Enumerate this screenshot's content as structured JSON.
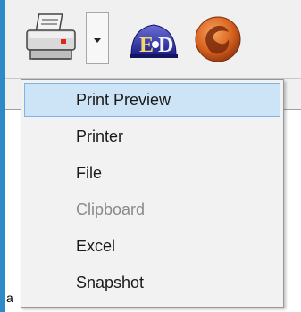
{
  "toolbar": {
    "printer_icon": "printer-icon",
    "dropdown_icon": "chevron-down-icon",
    "edb_icon": "edb-logo-icon",
    "orb_icon": "orange-swirl-icon",
    "edb_text": "E",
    "edb_text2": "D"
  },
  "menu": {
    "items": [
      {
        "label": "Print Preview",
        "state": "highlighted"
      },
      {
        "label": "Printer",
        "state": "enabled"
      },
      {
        "label": "File",
        "state": "enabled"
      },
      {
        "label": "Clipboard",
        "state": "disabled"
      },
      {
        "label": "Excel",
        "state": "enabled"
      },
      {
        "label": "Snapshot",
        "state": "enabled"
      }
    ]
  },
  "content": {
    "visible_text": "a"
  },
  "colors": {
    "frame_accent": "#2d89c8",
    "menu_highlight": "#cde4f7",
    "menu_highlight_border": "#7eb4ea"
  }
}
